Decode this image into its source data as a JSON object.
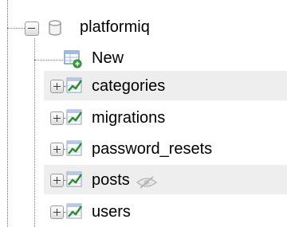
{
  "tree": {
    "database": {
      "name": "platformiq",
      "icon": "database-icon"
    },
    "new_item": {
      "label": "New",
      "icon": "new-table-icon"
    },
    "tables": [
      {
        "name": "categories",
        "highlighted": true,
        "icon": "table-icon"
      },
      {
        "name": "migrations",
        "highlighted": false,
        "icon": "table-icon"
      },
      {
        "name": "password_resets",
        "highlighted": false,
        "icon": "table-icon"
      },
      {
        "name": "posts",
        "highlighted": true,
        "icon": "table-icon",
        "extra_icon": "eye-hidden-icon"
      },
      {
        "name": "users",
        "highlighted": false,
        "icon": "table-icon"
      }
    ]
  },
  "colors": {
    "row_highlight": "#eeeeee",
    "table_icon_green": "#2e8b2e",
    "new_icon_badge": "#3aa63a"
  }
}
